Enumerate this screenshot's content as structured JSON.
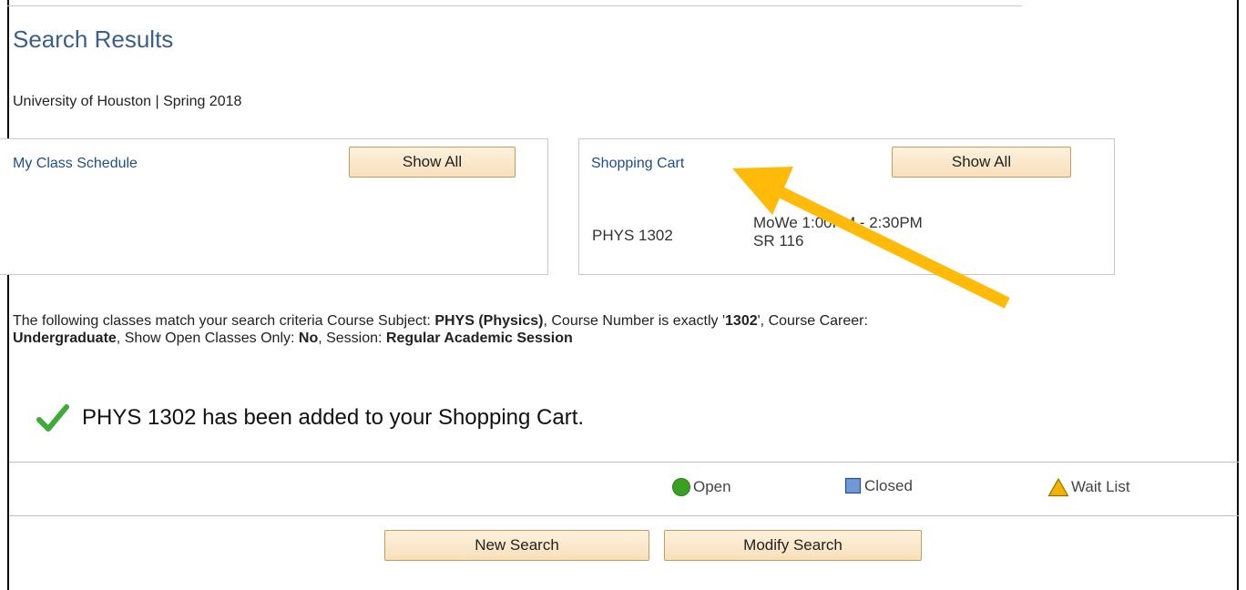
{
  "header": {
    "title": "Search Results",
    "institution": "University of Houston | Spring 2018"
  },
  "schedule_panel": {
    "link_label": "My Class Schedule",
    "show_all_label": "Show All"
  },
  "cart_panel": {
    "link_label": "Shopping Cart",
    "show_all_label": "Show All",
    "course": "PHYS 1302",
    "time_line1": "MoWe 1:00PM - 2:30PM",
    "time_line2": "SR 116"
  },
  "criteria": {
    "intro": "The following classes match your search criteria Course Subject: ",
    "subject": "PHYS (Physics)",
    "num_label": ",  Course Number is exactly '",
    "number": "1302",
    "career_label": "',  Course Career: ",
    "career": "Undergraduate",
    "open_label": ",  Show Open Classes Only: ",
    "open_value": "No",
    "session_label": ",  Session: ",
    "session": "Regular Academic Session"
  },
  "confirmation": {
    "icon": "checkmark-icon",
    "message": "PHYS 1302 has been added to your Shopping Cart."
  },
  "legend": {
    "open_label": "Open",
    "closed_label": "Closed",
    "waitlist_label": "Wait List"
  },
  "actions": {
    "new_search_label": "New Search",
    "modify_search_label": "Modify Search"
  },
  "colors": {
    "title": "#3b5e8c",
    "link": "#1f4e8c",
    "open": "#3aa020",
    "closed": "#6f98d8",
    "waitlist": "#f2b200",
    "arrow": "#ffba0a",
    "check": "#3fa93a"
  }
}
